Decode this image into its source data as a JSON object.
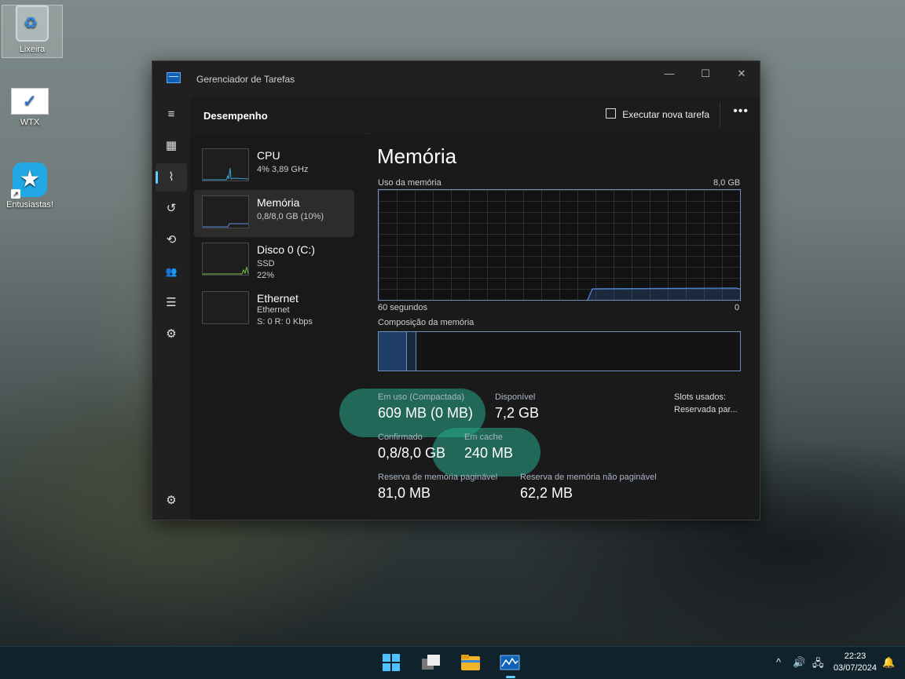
{
  "desktop": {
    "icons": [
      {
        "label": "Lixeira"
      },
      {
        "label": "WTX"
      },
      {
        "label": "Entusiastas!"
      }
    ]
  },
  "window": {
    "title": "Gerenciador de Tarefas",
    "controls": {
      "minimize": "—",
      "maximize": "☐",
      "close": "✕"
    }
  },
  "header": {
    "page_title": "Desempenho",
    "new_task_label": "Executar nova tarefa",
    "more_label": "•••"
  },
  "nav": {
    "items": [
      {
        "icon": "hamburger-icon",
        "glyph": "≡"
      },
      {
        "icon": "processes-icon",
        "glyph": "▦"
      },
      {
        "icon": "performance-icon",
        "glyph": "⌇"
      },
      {
        "icon": "history-icon",
        "glyph": "↺"
      },
      {
        "icon": "startup-icon",
        "glyph": "⟲"
      },
      {
        "icon": "users-icon",
        "glyph": "👥"
      },
      {
        "icon": "details-icon",
        "glyph": "☰"
      },
      {
        "icon": "services-icon",
        "glyph": "⚙"
      },
      {
        "icon": "settings-icon",
        "glyph": "⚙"
      }
    ]
  },
  "devices": [
    {
      "name": "CPU",
      "line1": "4% 3,89 GHz",
      "line2": ""
    },
    {
      "name": "Memória",
      "line1": "0,8/8,0 GB (10%)",
      "line2": ""
    },
    {
      "name": "Disco 0 (C:)",
      "line1": "SSD",
      "line2": "22%"
    },
    {
      "name": "Ethernet",
      "line1": "Ethernet",
      "line2": "S: 0 R: 0 Kbps"
    }
  ],
  "memory": {
    "title": "Memória",
    "usage_label": "Uso da memória",
    "usage_max": "8,0 GB",
    "time_left": "60 segundos",
    "time_right": "0",
    "composition_label": "Composição da memória",
    "usage_fraction": 0.1,
    "stats": {
      "in_use_label": "Em uso (Compactada)",
      "in_use_value": "609 MB (0 MB)",
      "available_label": "Disponível",
      "available_value": "7,2 GB",
      "slots_label": "Slots usados:",
      "reserved_label": "Reservada par...",
      "committed_label": "Confirmado",
      "committed_value": "0,8/8,0 GB",
      "cached_label": "Em cache",
      "cached_value": "240 MB",
      "paged_label": "Reserva de memória paginável",
      "paged_value": "81,0 MB",
      "nonpaged_label": "Reserva de memória não paginável",
      "nonpaged_value": "62,2 MB"
    }
  },
  "taskbar": {
    "apps": [
      "start-icon",
      "task-view-icon",
      "file-explorer-icon",
      "task-manager-icon"
    ],
    "tray": {
      "chevron": "^",
      "volume": "🔊",
      "network": "🖧"
    },
    "time": "22:23",
    "date": "03/07/2024"
  }
}
